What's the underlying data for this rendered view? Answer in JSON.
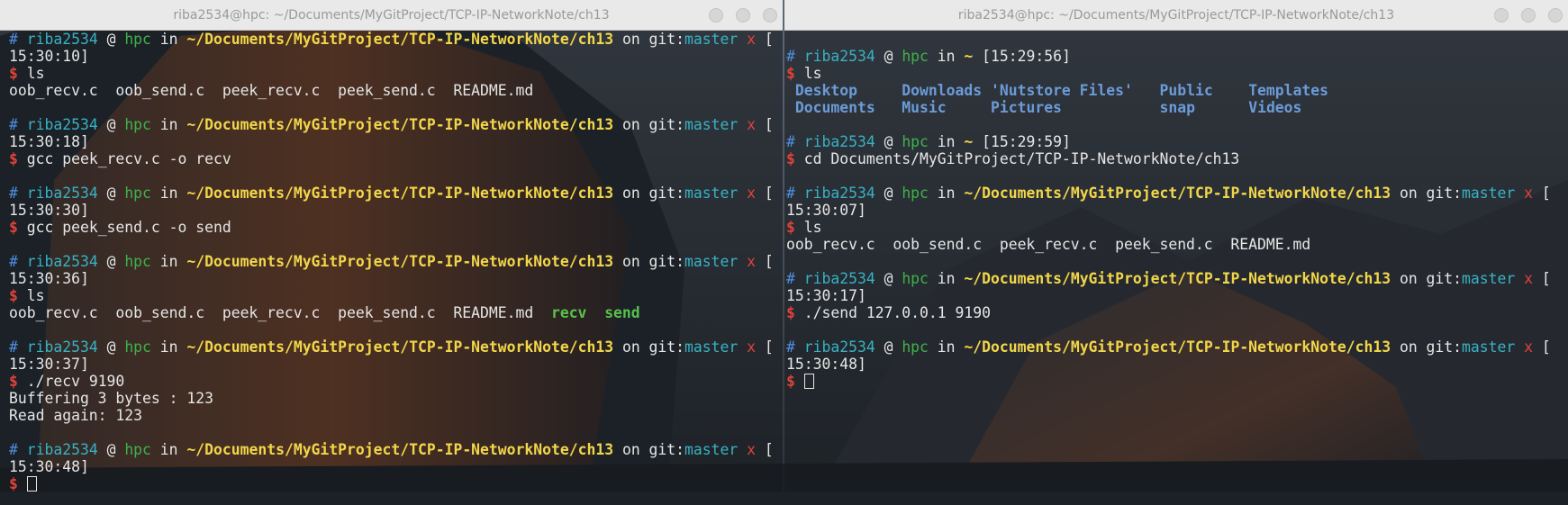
{
  "left_window": {
    "title": "riba2534@hpc: ~/Documents/MyGitProject/TCP-IP-NetworkNote/ch13"
  },
  "right_window": {
    "title": "riba2534@hpc: ~/Documents/MyGitProject/TCP-IP-NetworkNote/ch13"
  },
  "prompt": {
    "hash": "#",
    "user": "riba2534",
    "at": "@",
    "host": "hpc",
    "in": "in",
    "path_long": "~/Documents/MyGitProject/TCP-IP-NetworkNote/ch13",
    "path_home": "~",
    "on": "on",
    "git": "git:",
    "branch": "master",
    "dirty": "x",
    "bracket_open": "[",
    "dollar": "$"
  },
  "left_terminal": {
    "blocks": [
      {
        "time": "15:30:10]",
        "command": "ls",
        "output": [
          "oob_recv.c  oob_send.c  peek_recv.c  peek_send.c  README.md"
        ]
      },
      {
        "time": "15:30:18]",
        "command": "gcc peek_recv.c -o recv"
      },
      {
        "time": "15:30:30]",
        "command": "gcc peek_send.c -o send"
      },
      {
        "time": "15:30:36]",
        "command": "ls",
        "output_prefix": "oob_recv.c  oob_send.c  peek_recv.c  peek_send.c  README.md  ",
        "exec_files": [
          "recv",
          "send"
        ]
      },
      {
        "time": "15:30:37]",
        "command": "./recv 9190",
        "output": [
          "Buffering 3 bytes : 123",
          "Read again: 123"
        ]
      },
      {
        "time": "15:30:48]"
      }
    ]
  },
  "right_terminal": {
    "home_blocks": [
      {
        "time": "[15:29:56]",
        "command": "ls",
        "dir_rows": [
          [
            "Desktop",
            "Downloads",
            "'Nutstore Files'",
            "Public",
            "Templates"
          ],
          [
            "Documents",
            "Music",
            "Pictures",
            "snap",
            "Videos"
          ]
        ]
      },
      {
        "time": "[15:29:59]",
        "command": "cd Documents/MyGitProject/TCP-IP-NetworkNote/ch13"
      }
    ],
    "blocks": [
      {
        "time": "15:30:07]",
        "command": "ls",
        "output": [
          "oob_recv.c  oob_send.c  peek_recv.c  peek_send.c  README.md"
        ]
      },
      {
        "time": "15:30:17]",
        "command": "./send 127.0.0.1 9190"
      },
      {
        "time": "15:30:48]"
      }
    ]
  },
  "colors": {
    "path": "#f2d64a",
    "user": "#38b2c4",
    "host": "#3fb24a",
    "error_x": "#e0423a",
    "directory": "#6b9bd8",
    "executable": "#57c24b"
  }
}
